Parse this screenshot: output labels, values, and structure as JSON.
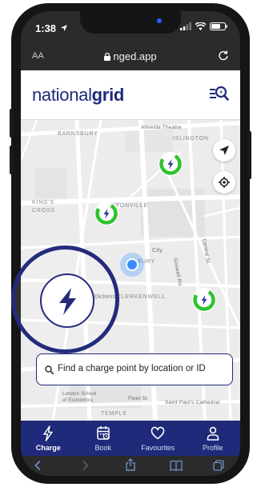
{
  "status_bar": {
    "time": "1:38"
  },
  "browser": {
    "text_size": "AA",
    "url": "nged.app"
  },
  "header": {
    "logo_light": "national",
    "logo_bold": "grid"
  },
  "map": {
    "labels": [
      "BARNSBURY",
      "Almeida Theatre",
      "ISLINGTON",
      "KING'S",
      "CROSS",
      "PENTONVILLE",
      "City",
      "Goswell Rd",
      "Central St",
      "SBURY",
      "CLERKENWELL",
      "Dickens",
      "London School",
      "of Economics",
      "Fleet St",
      "Saint Paul's Cathedral",
      "TEMPLE"
    ]
  },
  "search": {
    "placeholder": "Find a charge point by location or ID"
  },
  "nav": {
    "items": [
      {
        "label": "Charge",
        "icon": "bolt-icon"
      },
      {
        "label": "Book",
        "icon": "calendar-icon"
      },
      {
        "label": "Favourites",
        "icon": "heart-icon"
      },
      {
        "label": "Profile",
        "icon": "user-icon"
      }
    ]
  },
  "colors": {
    "brand": "#1f2a7a",
    "pin_green": "#2fc22f",
    "pin_bolt": "#2a3a9c",
    "location": "#3c8cff"
  }
}
